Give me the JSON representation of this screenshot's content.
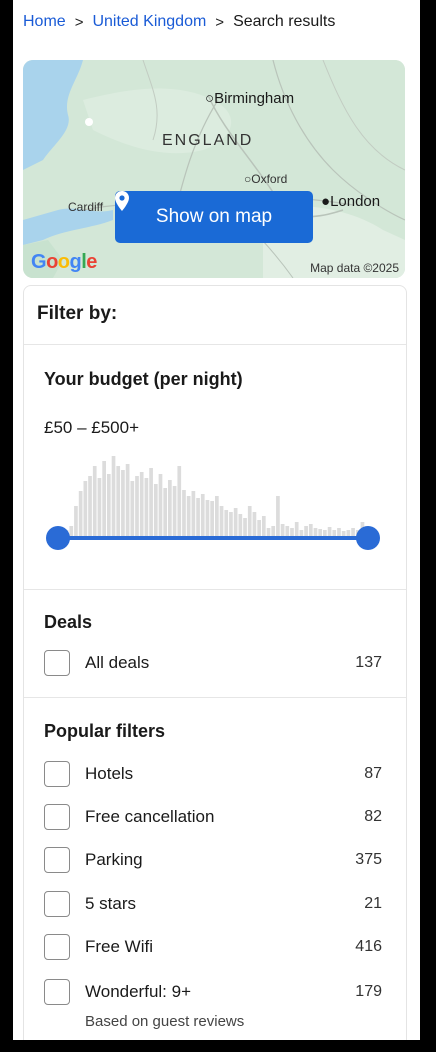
{
  "breadcrumb": {
    "items": [
      "Home",
      "United Kingdom",
      "Search results"
    ],
    "separator": ">"
  },
  "map": {
    "labels": {
      "birmingham": "Birmingham",
      "england": "ENGLAND",
      "oxford": "Oxford",
      "cardiff": "Cardiff",
      "london": "London"
    },
    "button_label": "Show on map",
    "credit": "Map data ©2025",
    "logo_text": "Google"
  },
  "filters": {
    "title": "Filter by:",
    "budget": {
      "title": "Your budget (per night)",
      "range_text": "£50 – £500+",
      "slider_min_fraction": 0.0,
      "slider_max_fraction": 1.0
    },
    "deals": {
      "title": "Deals",
      "items": [
        {
          "label": "All deals",
          "count": "137"
        }
      ]
    },
    "popular": {
      "title": "Popular filters",
      "items": [
        {
          "label": "Hotels",
          "count": "87"
        },
        {
          "label": "Free cancellation",
          "count": "82"
        },
        {
          "label": "Parking",
          "count": "375"
        },
        {
          "label": "5 stars",
          "count": "21"
        },
        {
          "label": "Free Wifi",
          "count": "416"
        },
        {
          "label": "Wonderful: 9+",
          "count": "179"
        }
      ],
      "note": "Based on guest reviews"
    }
  },
  "colors": {
    "link": "#1a5bd6",
    "accent": "#1a6ad6",
    "slider": "#2a6bd6"
  }
}
